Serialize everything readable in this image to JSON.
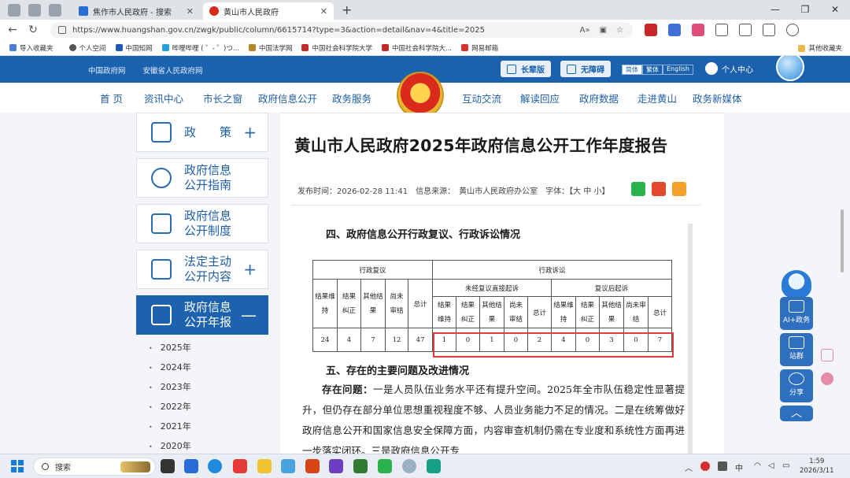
{
  "browser": {
    "tabs": [
      {
        "title": "焦作市人民政府 - 搜索",
        "active": false
      },
      {
        "title": "黄山市人民政府",
        "active": true
      }
    ],
    "url": "https://www.huangshan.gov.cn/zwgk/public/column/6615714?type=3&action=detail&nav=4&title=2025",
    "bookmarks": [
      "导入收藏夹",
      "个人空间",
      "中国知网",
      "哔哩哔哩 ( ゜- ゜)つ...",
      "中国法学网",
      "中国社会科学院大学",
      "中国社会科学院大...",
      "网易邮箱"
    ],
    "other_bookmarks": "其他收藏夹"
  },
  "site": {
    "top_links": [
      "中国政府网",
      "安徽省人民政府网"
    ],
    "elder_button": "长辈版",
    "accessible_button": "无障碍",
    "lang": [
      "简体",
      "繁体",
      "English"
    ],
    "user_center": "个人中心",
    "nav": [
      "首 页",
      "资讯中心",
      "市长之窗",
      "政府信息公开",
      "政务服务",
      "互动交流",
      "解读回应",
      "政府数据",
      "走进黄山",
      "政务新媒体"
    ]
  },
  "sidebar": {
    "items": [
      {
        "label": "政　　策",
        "icon": "document-icon",
        "expandable": true,
        "active": false
      },
      {
        "label": "政府信息公开指南",
        "icon": "compass-icon",
        "expandable": false,
        "active": false
      },
      {
        "label": "政府信息公开制度",
        "icon": "list-icon",
        "expandable": false,
        "active": false
      },
      {
        "label": "法定主动公开内容",
        "icon": "clipboard-icon",
        "expandable": true,
        "active": false
      },
      {
        "label": "政府信息公开年报",
        "icon": "folder-icon",
        "expandable": true,
        "active": true
      }
    ],
    "years": [
      "2025年",
      "2024年",
      "2023年",
      "2022年",
      "2021年",
      "2020年"
    ]
  },
  "article": {
    "title": "黄山市人民政府2025年政府信息公开工作年度报告",
    "published": "发布时间：2026-02-28 11:41",
    "source": "信息来源：　黄山市人民政府办公室",
    "font_size": "字体：【大 中 小】",
    "section4": "四、政府信息公开行政复议、行政诉讼情况",
    "section5": "五、存在的主要问题及改进情况",
    "problem_label": "存在问题：",
    "problem_text": "一是人员队伍业务水平还有提升空间。2025年全市队伍稳定性显著提升，但仍存在部分单位思想重视程度不够、人员业务能力不足的情况。二是在统筹做好政府信息公开和国家信息安全保障方面，内容审查机制仍需在专业度和系统性方面再进一步落实闭环。三是政府信息公开专"
  },
  "table": {
    "h_admin_review": "行政复议",
    "h_litigation": "行政诉讼",
    "h_direct": "未经复议直接起诉",
    "h_after": "复议后起诉",
    "admin_cols": [
      "结果维持",
      "结果纠正",
      "其他结果",
      "尚未审结",
      "总计"
    ],
    "lit_cols": [
      "结果维持",
      "结果纠正",
      "其他结果",
      "尚未审结",
      "总计"
    ],
    "admin_values": [
      "24",
      "4",
      "7",
      "12",
      "47"
    ],
    "direct_values": [
      "1",
      "0",
      "1",
      "0",
      "2"
    ],
    "after_values": [
      "4",
      "0",
      "3",
      "0",
      "7"
    ]
  },
  "float_tools": [
    "AI+政务",
    "站群",
    "分享"
  ],
  "taskbar": {
    "search": "搜索",
    "ime": "中",
    "time": "1:59",
    "date": "2026/3/11"
  }
}
